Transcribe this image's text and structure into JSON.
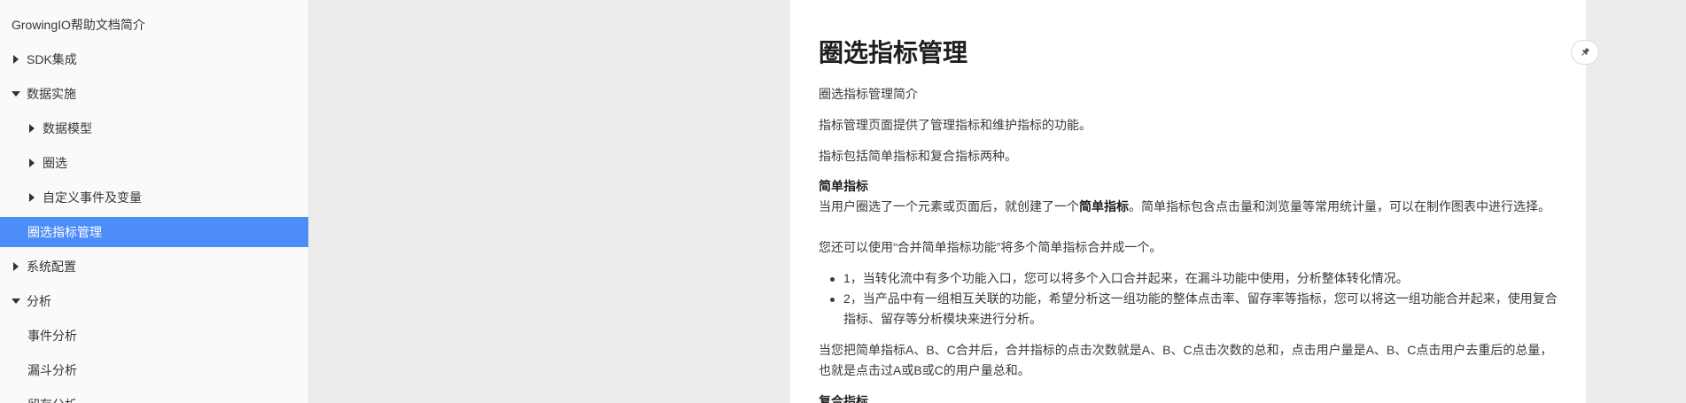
{
  "sidebar": {
    "title": "GrowingIO帮助文档简介",
    "items": [
      {
        "label": "SDK集成",
        "caret": "right"
      },
      {
        "label": "数据实施",
        "caret": "down"
      },
      {
        "label": "数据模型",
        "caret": "right"
      },
      {
        "label": "圈选",
        "caret": "right"
      },
      {
        "label": "自定义事件及变量",
        "caret": "right"
      },
      {
        "label": "圈选指标管理",
        "active": true
      },
      {
        "label": "系统配置",
        "caret": "right"
      },
      {
        "label": "分析",
        "caret": "down"
      },
      {
        "label": "事件分析"
      },
      {
        "label": "漏斗分析"
      },
      {
        "label": "留存分析"
      }
    ]
  },
  "content": {
    "title": "圈选指标管理",
    "intro": "圈选指标管理简介",
    "p1": "指标管理页面提供了管理指标和维护指标的功能。",
    "p2": "指标包括简单指标和复合指标两种。",
    "simple_heading": "简单指标",
    "simple_text_before": "当用户圈选了一个元素或页面后，就创建了一个",
    "simple_text_bold": "简单指标",
    "simple_text_after": "。简单指标包含点击量和浏览量等常用统计量，可以在制作图表中进行选择。",
    "merge_text": "您还可以使用“合并简单指标功能”将多个简单指标合并成一个。",
    "bullets": [
      "1，当转化流中有多个功能入口，您可以将多个入口合并起来，在漏斗功能中使用，分析整体转化情况。",
      "2，当产品中有一组相互关联的功能，希望分析这一组功能的整体点击率、留存率等指标，您可以将这一组功能合并起来，使用复合指标、留存等分析模块来进行分析。"
    ],
    "merge_example": "当您把简单指标A、B、C合并后，合并指标的点击次数就是A、B、C点击次数的总和，点击用户量是A、B、C点击用户去重后的总量，也就是点击过A或B或C的用户量总和。",
    "complex_heading": "复合指标"
  },
  "toolbar": {
    "pin_icon": "pin-icon"
  },
  "colors": {
    "active_bg": "#4d8df8",
    "gutter": "#ececec"
  }
}
